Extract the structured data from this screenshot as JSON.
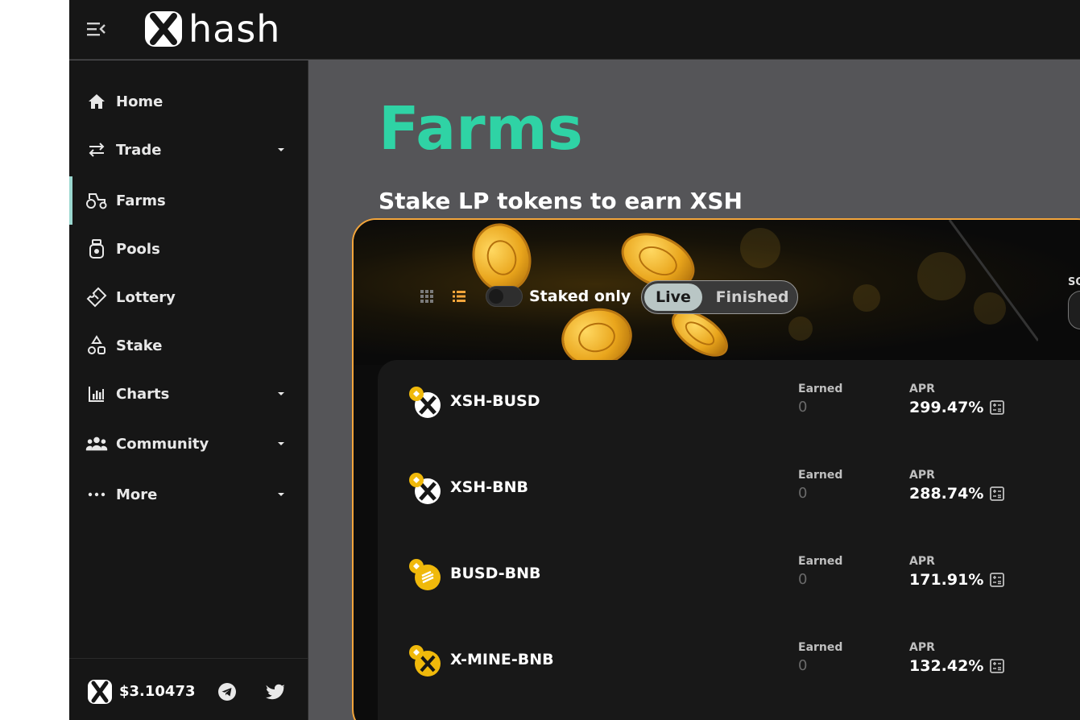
{
  "brand": {
    "name": "hash"
  },
  "sidebar": {
    "items": [
      {
        "label": "Home",
        "icon": "home-icon",
        "has_caret": false,
        "active": false
      },
      {
        "label": "Trade",
        "icon": "swap-arrows-icon",
        "has_caret": true,
        "active": false
      },
      {
        "label": "Farms",
        "icon": "tractor-icon",
        "has_caret": false,
        "active": true
      },
      {
        "label": "Pools",
        "icon": "pool-jar-icon",
        "has_caret": false,
        "active": false
      },
      {
        "label": "Lottery",
        "icon": "ticket-icon",
        "has_caret": false,
        "active": false
      },
      {
        "label": "Stake",
        "icon": "shapes-icon",
        "has_caret": false,
        "active": false
      },
      {
        "label": "Charts",
        "icon": "bar-chart-icon",
        "has_caret": true,
        "active": false
      },
      {
        "label": "Community",
        "icon": "people-icon",
        "has_caret": true,
        "active": false
      },
      {
        "label": "More",
        "icon": "more-dots-icon",
        "has_caret": true,
        "active": false
      }
    ],
    "footer": {
      "price": "$3.10473",
      "social": [
        "telegram-icon",
        "twitter-icon"
      ]
    }
  },
  "page": {
    "title": "Farms",
    "subtitle": "Stake LP tokens to earn XSH"
  },
  "filters": {
    "staked_only_label": "Staked only",
    "staked_only": false,
    "tab_live": "Live",
    "tab_finished": "Finished",
    "selected_tab": "Live",
    "sort_label": "SO"
  },
  "farms": [
    {
      "pair": "XSH-BUSD",
      "earned_label": "Earned",
      "earned": "0",
      "apr_label": "APR",
      "apr": "299.47%"
    },
    {
      "pair": "XSH-BNB",
      "earned_label": "Earned",
      "earned": "0",
      "apr_label": "APR",
      "apr": "288.74%"
    },
    {
      "pair": "BUSD-BNB",
      "earned_label": "Earned",
      "earned": "0",
      "apr_label": "APR",
      "apr": "171.91%"
    },
    {
      "pair": "X-MINE-BNB",
      "earned_label": "Earned",
      "earned": "0",
      "apr_label": "APR",
      "apr": "132.42%"
    }
  ],
  "colors": {
    "accent": "#2fd3a5",
    "card_border": "#f3a53b",
    "coin": "#e9a51c"
  }
}
